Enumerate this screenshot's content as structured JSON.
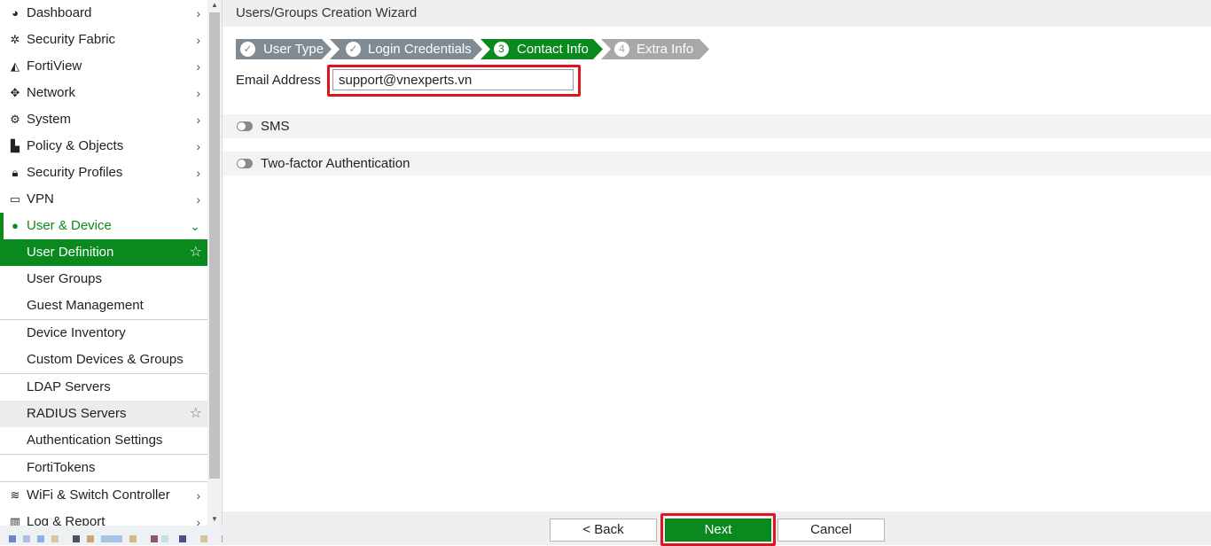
{
  "sidebar": {
    "items": [
      {
        "label": "Dashboard",
        "icon": "dashboard-icon"
      },
      {
        "label": "Security Fabric",
        "icon": "security-fabric-icon"
      },
      {
        "label": "FortiView",
        "icon": "fortiview-icon"
      },
      {
        "label": "Network",
        "icon": "network-icon"
      },
      {
        "label": "System",
        "icon": "gear-icon"
      },
      {
        "label": "Policy & Objects",
        "icon": "policy-icon"
      },
      {
        "label": "Security Profiles",
        "icon": "lock-icon"
      },
      {
        "label": "VPN",
        "icon": "laptop-icon"
      },
      {
        "label": "User & Device",
        "icon": "user-icon"
      }
    ],
    "sub_items": [
      {
        "label": "User Definition"
      },
      {
        "label": "User Groups"
      },
      {
        "label": "Guest Management"
      },
      {
        "label": "Device Inventory"
      },
      {
        "label": "Custom Devices & Groups"
      },
      {
        "label": "LDAP Servers"
      },
      {
        "label": "RADIUS Servers"
      },
      {
        "label": "Authentication Settings"
      },
      {
        "label": "FortiTokens"
      }
    ],
    "bottom_items": [
      {
        "label": "WiFi & Switch Controller",
        "icon": "wifi-icon"
      },
      {
        "label": "Log & Report",
        "icon": "chart-icon"
      }
    ]
  },
  "wizard": {
    "title": "Users/Groups Creation Wizard",
    "steps": [
      {
        "label": "User Type",
        "marker": "✓",
        "state": "done"
      },
      {
        "label": "Login Credentials",
        "marker": "✓",
        "state": "done"
      },
      {
        "label": "Contact Info",
        "marker": "3",
        "state": "current"
      },
      {
        "label": "Extra Info",
        "marker": "4",
        "state": "todo"
      }
    ],
    "email_label": "Email Address",
    "email_value": "support@vnexperts.vn",
    "sms_label": "SMS",
    "two_factor_label": "Two-factor Authentication"
  },
  "footer": {
    "back_label": "< Back",
    "next_label": "Next",
    "cancel_label": "Cancel"
  },
  "colors": {
    "accent_green": "#0a8a1e",
    "highlight_red": "#e0141c",
    "step_done_gray": "#808a93",
    "step_todo_gray": "#a8a8a8"
  }
}
